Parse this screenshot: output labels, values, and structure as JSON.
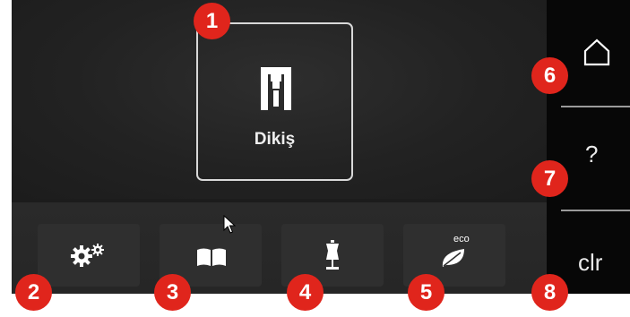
{
  "main": {
    "sewing_tile": {
      "label": "Dikiş",
      "icon": "presser-foot-icon"
    }
  },
  "bottom_bar": {
    "buttons": [
      {
        "icon": "settings-gears-icon"
      },
      {
        "icon": "open-book-icon"
      },
      {
        "icon": "dress-form-icon"
      },
      {
        "icon": "eco-leaf-icon",
        "badge": "eco"
      }
    ]
  },
  "side_panel": {
    "home": {
      "icon": "home-icon"
    },
    "help": {
      "label": "?"
    },
    "clear": {
      "label": "clr"
    }
  },
  "callouts": [
    "1",
    "2",
    "3",
    "4",
    "5",
    "6",
    "7",
    "8"
  ],
  "colors": {
    "callout": "#e0251c",
    "background": "#1f1f1f",
    "side_panel": "#070707"
  }
}
